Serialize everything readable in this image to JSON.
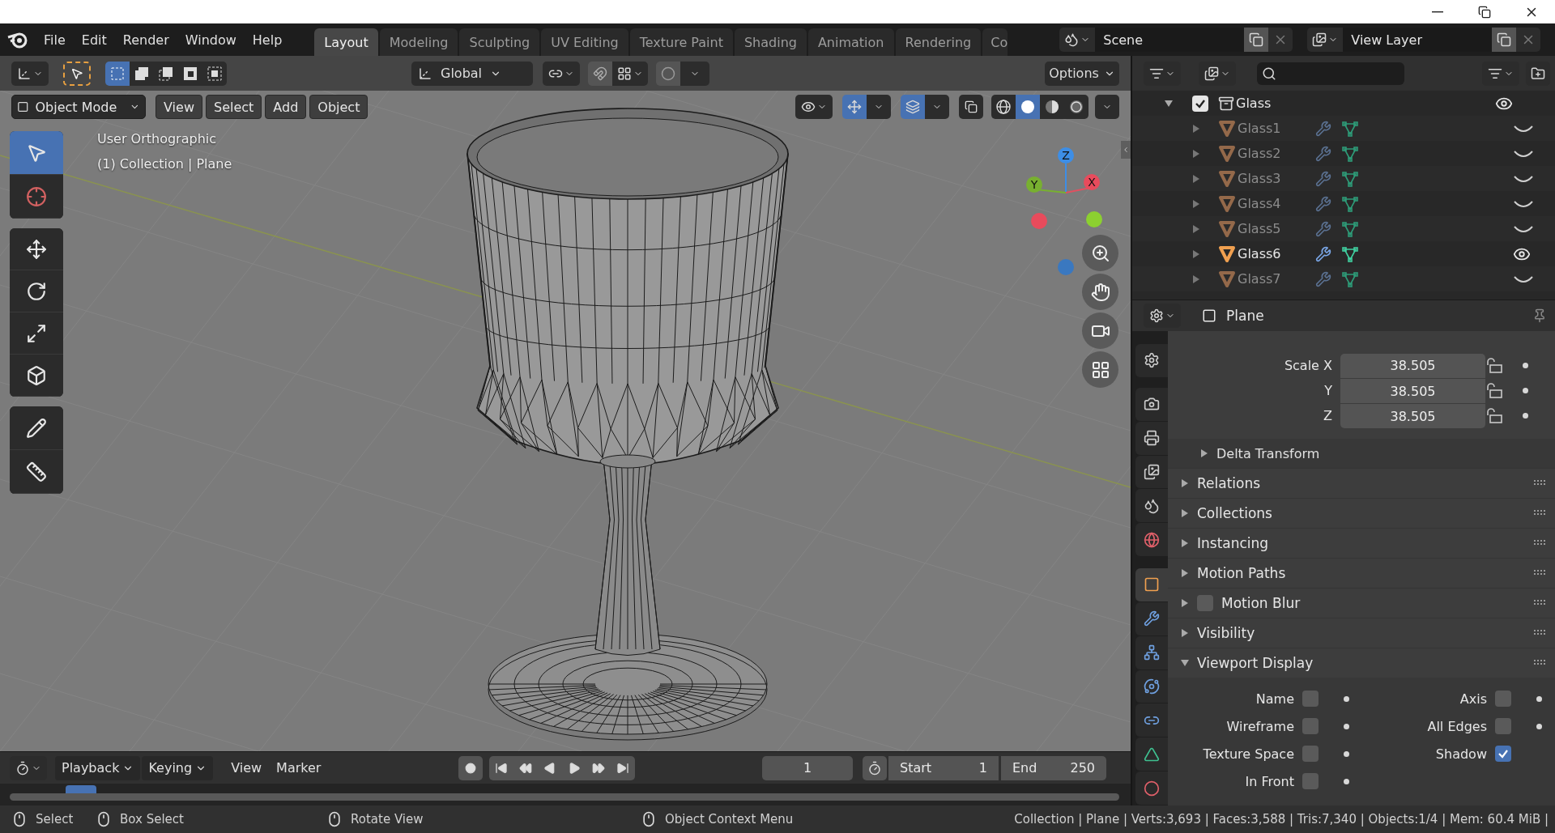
{
  "menu": [
    "File",
    "Edit",
    "Render",
    "Window",
    "Help"
  ],
  "workspaces": [
    {
      "label": "Layout",
      "selected": true
    },
    {
      "label": "Modeling",
      "selected": false
    },
    {
      "label": "Sculpting",
      "selected": false
    },
    {
      "label": "UV Editing",
      "selected": false
    },
    {
      "label": "Texture Paint",
      "selected": false
    },
    {
      "label": "Shading",
      "selected": false
    },
    {
      "label": "Animation",
      "selected": false
    },
    {
      "label": "Rendering",
      "selected": false
    },
    {
      "label": "Co",
      "selected": false
    }
  ],
  "scene": {
    "name": "Scene"
  },
  "view_layer": {
    "name": "View Layer"
  },
  "tool_header": {
    "select_modes": [
      {
        "selected": true
      },
      {
        "selected": false
      },
      {
        "selected": false
      },
      {
        "selected": false
      },
      {
        "selected": false
      }
    ],
    "orientation": "Global",
    "options": "Options"
  },
  "viewport": {
    "mode": "Object Mode",
    "menus": [
      "View",
      "Select",
      "Add",
      "Object"
    ],
    "view_name": "User Orthographic",
    "info": "(1) Collection | Plane",
    "shading": [
      {
        "selected": false
      },
      {
        "selected": true
      },
      {
        "selected": false
      },
      {
        "selected": false
      }
    ],
    "tools": [
      {
        "selected": true
      },
      {
        "selected": false
      },
      {
        "selected": false
      },
      {
        "selected": false
      },
      {
        "selected": false
      },
      {
        "selected": false
      },
      {
        "selected": false
      },
      {
        "selected": false
      }
    ],
    "gizmo": {
      "z": "Z",
      "y": "Y",
      "x": "X"
    }
  },
  "outliner": {
    "collection": {
      "label": "Glass",
      "checked": true,
      "expanded": true,
      "children": [
        {
          "label": "Glass1",
          "expanded": false,
          "visible": false
        },
        {
          "label": "Glass2",
          "expanded": false,
          "visible": false
        },
        {
          "label": "Glass3",
          "expanded": false,
          "visible": false
        },
        {
          "label": "Glass4",
          "expanded": false,
          "visible": false
        },
        {
          "label": "Glass5",
          "expanded": false,
          "visible": false
        },
        {
          "label": "Glass6",
          "expanded": false,
          "visible": true
        },
        {
          "label": "Glass7",
          "expanded": false,
          "visible": false
        }
      ]
    }
  },
  "properties": {
    "object": "Plane",
    "tabs": [
      {
        "selected": false
      },
      {
        "selected": false
      },
      {
        "selected": false
      },
      {
        "selected": false
      },
      {
        "selected": false
      },
      {
        "selected": false
      },
      {
        "selected": true
      },
      {
        "selected": false
      },
      {
        "selected": false
      },
      {
        "selected": false
      },
      {
        "selected": false
      },
      {
        "selected": false
      },
      {
        "selected": false
      }
    ],
    "scale": [
      {
        "label": "Scale X",
        "value": "38.505"
      },
      {
        "label": "Y",
        "value": "38.505"
      },
      {
        "label": "Z",
        "value": "38.505"
      }
    ],
    "delta": {
      "label": "Delta Transform",
      "expanded": false
    },
    "panels": [
      {
        "label": "Relations",
        "kind": "plain",
        "expanded": false
      },
      {
        "label": "Collections",
        "kind": "plain",
        "expanded": false
      },
      {
        "label": "Instancing",
        "kind": "plain",
        "expanded": false
      },
      {
        "label": "Motion Paths",
        "kind": "plain",
        "expanded": false
      },
      {
        "label": "Motion Blur",
        "kind": "checkbox",
        "checked": false,
        "expanded": false
      },
      {
        "label": "Visibility",
        "kind": "plain",
        "expanded": false
      },
      {
        "label": "Viewport Display",
        "kind": "plain",
        "expanded": true
      }
    ],
    "display_options": [
      {
        "label": "Name",
        "checked": false
      },
      {
        "label": "Axis",
        "checked": false
      },
      {
        "label": "Wireframe",
        "checked": false
      },
      {
        "label": "All Edges",
        "checked": false
      },
      {
        "label": "Texture Space",
        "checked": false
      },
      {
        "label": "Shadow",
        "checked": true
      },
      {
        "label": "In Front",
        "checked": false
      }
    ]
  },
  "timeline": {
    "menus": [
      {
        "label": "Playback",
        "kind": "dropdown"
      },
      {
        "label": "Keying",
        "kind": "dropdown"
      },
      {
        "label": "View",
        "kind": "plain"
      },
      {
        "label": "Marker",
        "kind": "plain"
      }
    ],
    "frame": "1",
    "start": {
      "label": "Start",
      "value": "1"
    },
    "end": {
      "label": "End",
      "value": "250"
    }
  },
  "status_bar": {
    "hints": [
      "Select",
      "Box Select",
      "Rotate View",
      "Object Context Menu"
    ],
    "stats": "Collection | Plane | Verts:3,693 | Faces:3,588 | Tris:7,340 | Objects:1/4 | Mem: 60.4 MiB |"
  }
}
